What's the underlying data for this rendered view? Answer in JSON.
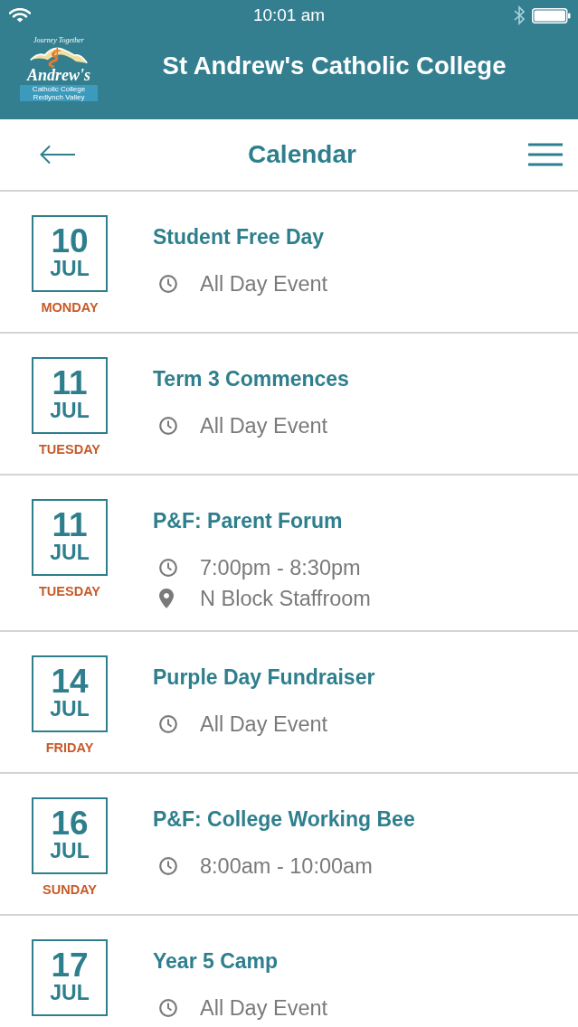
{
  "status_bar": {
    "time": "10:01 am"
  },
  "header": {
    "logo": {
      "tagline": "Journey Together",
      "wordmark": "Andrew's",
      "subtitle": "Catholic College Redlynch Valley"
    },
    "title": "St Andrew's Catholic College"
  },
  "nav": {
    "title": "Calendar"
  },
  "events": [
    {
      "day": "10",
      "month": "JUL",
      "weekday": "MONDAY",
      "title": "Student Free Day",
      "details": [
        {
          "kind": "time",
          "text": "All Day Event"
        }
      ]
    },
    {
      "day": "11",
      "month": "JUL",
      "weekday": "TUESDAY",
      "title": "Term 3 Commences",
      "details": [
        {
          "kind": "time",
          "text": "All Day Event"
        }
      ]
    },
    {
      "day": "11",
      "month": "JUL",
      "weekday": "TUESDAY",
      "title": "P&F: Parent Forum",
      "details": [
        {
          "kind": "time",
          "text": "7:00pm - 8:30pm"
        },
        {
          "kind": "location",
          "text": "N Block Staffroom"
        }
      ]
    },
    {
      "day": "14",
      "month": "JUL",
      "weekday": "FRIDAY",
      "title": "Purple Day Fundraiser",
      "details": [
        {
          "kind": "time",
          "text": "All Day Event"
        }
      ]
    },
    {
      "day": "16",
      "month": "JUL",
      "weekday": "SUNDAY",
      "title": "P&F: College Working Bee",
      "details": [
        {
          "kind": "time",
          "text": "8:00am - 10:00am"
        }
      ]
    },
    {
      "day": "17",
      "month": "JUL",
      "title": "Year 5 Camp",
      "details": [
        {
          "kind": "time",
          "text": "All Day Event"
        }
      ]
    }
  ]
}
